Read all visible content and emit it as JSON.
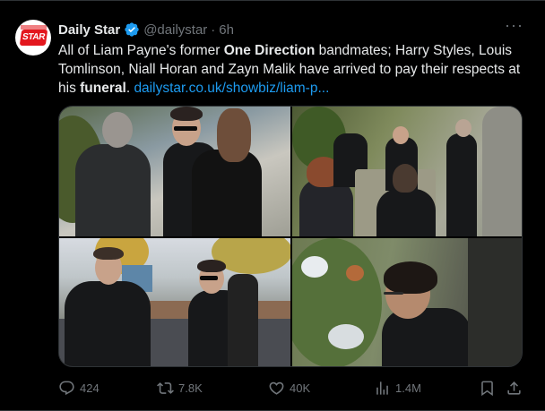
{
  "tweet": {
    "author_name": "Daily Star",
    "handle": "@dailystar",
    "separator": "·",
    "time": "6h",
    "avatar_text": "STAR",
    "text_1": "All of Liam Payne's former ",
    "text_bold_1": "One Direction",
    "text_2": " bandmates; Harry Styles, Louis Tomlinson, Niall Horan and Zayn Malik have arrived to pay their respects at his ",
    "text_bold_2": "funeral",
    "text_3": ". ",
    "link": "dailystar.co.uk/showbiz/liam-p..."
  },
  "actions": {
    "replies": "424",
    "reposts": "7.8K",
    "likes": "40K",
    "views": "1.4M"
  },
  "colors": {
    "accent": "#1d9bf0",
    "muted": "#71767b",
    "text": "#e7e9ea",
    "brand": "#e3171e"
  }
}
